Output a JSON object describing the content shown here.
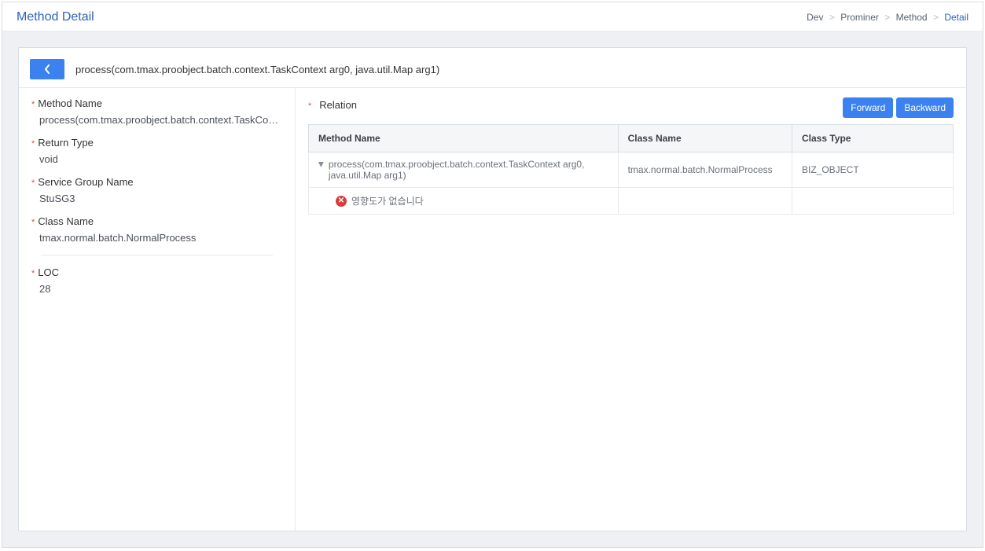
{
  "header": {
    "title": "Method Detail",
    "breadcrumb": {
      "item0": "Dev",
      "item1": "Prominer",
      "item2": "Method",
      "item3": "Detail"
    }
  },
  "method_signature": "process(com.tmax.proobject.batch.context.TaskContext arg0, java.util.Map arg1)",
  "details": {
    "method_name_label": "Method Name",
    "method_name_value": "process(com.tmax.proobject.batch.context.TaskContex…",
    "return_type_label": "Return Type",
    "return_type_value": "void",
    "service_group_label": "Service Group Name",
    "service_group_value": "StuSG3",
    "class_name_label": "Class Name",
    "class_name_value": "tmax.normal.batch.NormalProcess",
    "loc_label": "LOC",
    "loc_value": "28"
  },
  "relation": {
    "title": "Relation",
    "buttons": {
      "forward": "Forward",
      "backward": "Backward"
    },
    "columns": {
      "method_name": "Method Name",
      "class_name": "Class Name",
      "class_type": "Class Type"
    },
    "rows": [
      {
        "method_name": "process(com.tmax.proobject.batch.context.TaskContext arg0, java.util.Map arg1)",
        "class_name": "tmax.normal.batch.NormalProcess",
        "class_type": "BIZ_OBJECT"
      }
    ],
    "no_impact_message": "영향도가 없습니다"
  }
}
